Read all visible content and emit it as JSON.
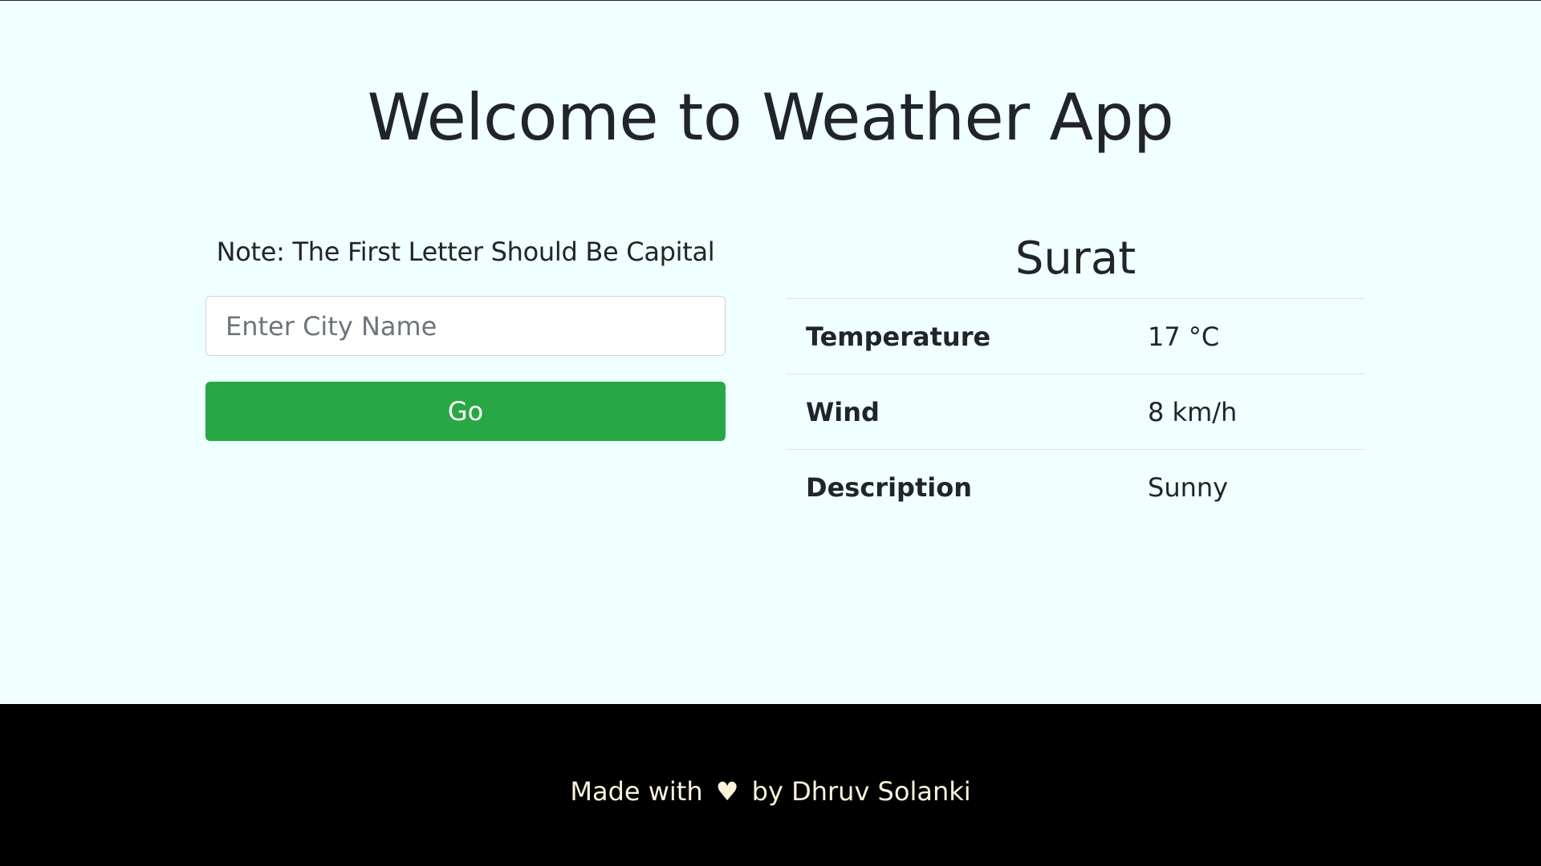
{
  "page": {
    "title": "Welcome to Weather App"
  },
  "search": {
    "note": "Note: The First Letter Should Be Capital",
    "placeholder": "Enter City Name",
    "value": "",
    "go_label": "Go"
  },
  "weather": {
    "city": "Surat",
    "rows": [
      {
        "label": "Temperature",
        "value": "17 °C"
      },
      {
        "label": "Wind",
        "value": "8 km/h"
      },
      {
        "label": "Description",
        "value": "Sunny"
      }
    ]
  },
  "footer": {
    "made_with": "Made with",
    "heart_icon": "heart-icon",
    "by": "by Dhruv Solanki"
  },
  "colors": {
    "background": "#f0ffff",
    "button": "#28a745",
    "footer_bg": "#000000",
    "footer_text": "#fff2da"
  }
}
